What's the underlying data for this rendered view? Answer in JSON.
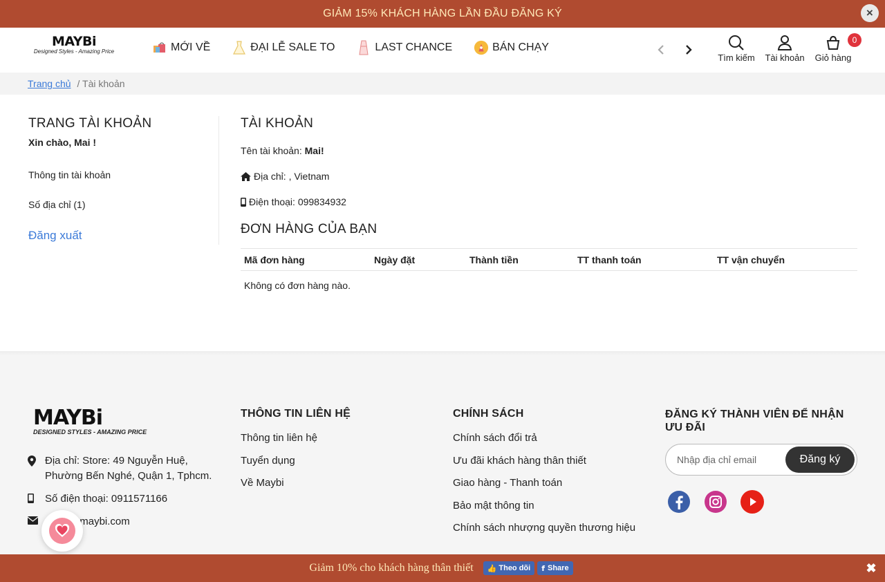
{
  "promo_top": {
    "text": "GIẢM 15% KHÁCH HÀNG LẦN ĐẦU ĐĂNG KÝ",
    "close_symbol": "×"
  },
  "header": {
    "logo": {
      "brand": "MAYBi",
      "tagline": "Designed Styles - Amazing Price"
    },
    "nav": [
      {
        "label": "MỚI VỀ",
        "icon": "shopping-bags-icon"
      },
      {
        "label": "ĐẠI LỄ SALE TO",
        "icon": "dress-icon"
      },
      {
        "label": "LAST CHANCE",
        "icon": "dress-tag-icon"
      },
      {
        "label": "BÁN CHẠY",
        "icon": "bestseller-badge-icon"
      }
    ],
    "tools": {
      "search": "Tìm kiếm",
      "account": "Tài khoản",
      "cart": "Giỏ hàng",
      "cart_count": "0"
    }
  },
  "breadcrumb": {
    "home": "Trang chủ",
    "current": "/ Tài khoản"
  },
  "sidebar": {
    "title": "TRANG TÀI KHOẢN",
    "greeting": "Xin chào, Mai !",
    "links": [
      "Thông tin tài khoản",
      "Số địa chỉ (1)"
    ],
    "logout": "Đăng xuất"
  },
  "account": {
    "title": "TÀI KHOẢN",
    "name_label": "Tên tài khoản: ",
    "name_value": "Mai!",
    "address": "Địa chỉ: , Vietnam",
    "phone": "Điện thoại: 099834932"
  },
  "orders": {
    "title": "ĐƠN HÀNG CỦA BẠN",
    "columns": [
      "Mã đơn hàng",
      "Ngày đặt",
      "Thành tiền",
      "TT thanh toán",
      "TT vận chuyển"
    ],
    "empty_text": "Không có đơn hàng nào."
  },
  "footer": {
    "logo": {
      "brand": "MAYBi",
      "tagline": "DESIGNED STYLES - AMAZING PRICE"
    },
    "contact": {
      "address": "Địa chỉ: Store: 49 Nguyễn Huệ, Phường Bến Nghé, Quận 1, Tphcm.",
      "phone": "Số điện thoại: 0911571166",
      "email": "sales@maybi.com"
    },
    "info_col": {
      "title": "THÔNG TIN LIÊN HỆ",
      "links": [
        "Thông tin liên hệ",
        "Tuyển dụng",
        "Về Maybi"
      ]
    },
    "policy_col": {
      "title": "CHÍNH SÁCH",
      "links": [
        "Chính sách đổi trả",
        "Ưu đãi khách hàng thân thiết",
        "Giao hàng - Thanh toán",
        "Bảo mật thông tin",
        "Chính sách nhượng quyền thương hiệu"
      ]
    },
    "subscribe": {
      "title": "ĐĂNG KÝ THÀNH VIÊN ĐỂ NHẬN ƯU ĐÃI",
      "placeholder": "Nhập địa chỉ email",
      "button": "Đăng ký"
    },
    "socials": [
      "facebook-icon",
      "instagram-icon",
      "youtube-icon"
    ]
  },
  "bottom_bar": {
    "text": "Giảm 10% cho khách hàng thân thiết",
    "follow": "Theo dõi",
    "share": "Share"
  },
  "colors": {
    "promo_bg": "#b04b30",
    "promo_text": "#ffe9b8",
    "link_blue": "#3b7ad8",
    "badge_red": "#e0333c",
    "facebook_blue": "#4267b2"
  }
}
